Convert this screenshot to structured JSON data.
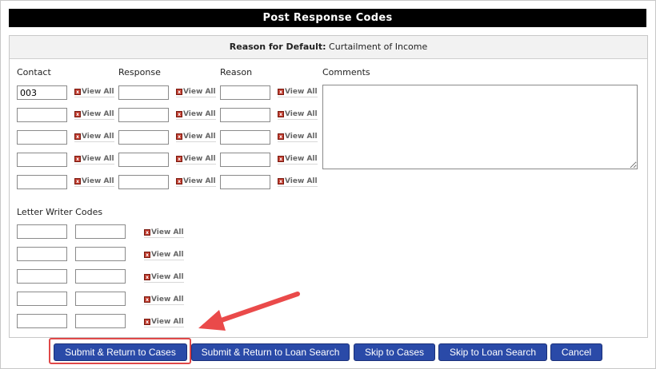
{
  "dialog": {
    "title": "Post Response Codes",
    "reason_label": "Reason for Default:",
    "reason_value": "Curtailment of Income"
  },
  "columns": {
    "contact": "Contact",
    "response": "Response",
    "reason": "Reason",
    "comments": "Comments"
  },
  "view_all_label": "View All",
  "contact_values": [
    "003",
    "",
    "",
    "",
    ""
  ],
  "letter_writer": {
    "label": "Letter Writer Codes"
  },
  "comments_value": "",
  "buttons": {
    "submit_cases": "Submit & Return to Cases",
    "submit_loan": "Submit & Return to Loan Search",
    "skip_cases": "Skip to Cases",
    "skip_loan": "Skip to Loan Search",
    "cancel": "Cancel"
  },
  "colors": {
    "button_bg": "#2a4aa8",
    "highlight": "#e04848",
    "title_bg": "#000000"
  },
  "icons": {
    "view_all": "external-link-icon",
    "annotation": "red-arrow-icon"
  }
}
